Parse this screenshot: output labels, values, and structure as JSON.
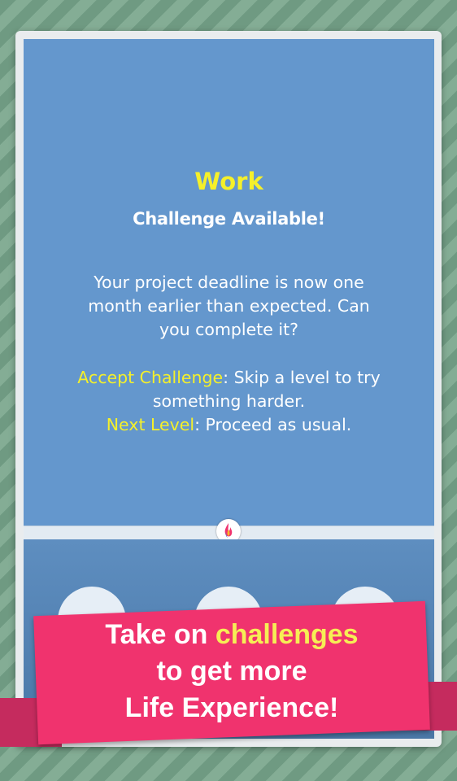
{
  "card": {
    "title": "Work",
    "subtitle": "Challenge Available!",
    "description": "Your project deadline is now one month earlier than expected. Can you complete it?",
    "options": [
      {
        "label": "Accept Challenge",
        "text": ": Skip a level to try something harder."
      },
      {
        "label": "Next Level",
        "text": ": Proceed as usual."
      }
    ]
  },
  "banner": {
    "line1_prefix": "Take on ",
    "line1_highlight": "challenges",
    "line2": "to get more",
    "line3": "Life Experience!"
  },
  "icons": [
    "flame-logo-icon"
  ],
  "colors": {
    "card_background": "#6497cd",
    "highlight": "#f5f02a",
    "banner": "#f0336e",
    "banner_highlight": "#f6ee55"
  }
}
